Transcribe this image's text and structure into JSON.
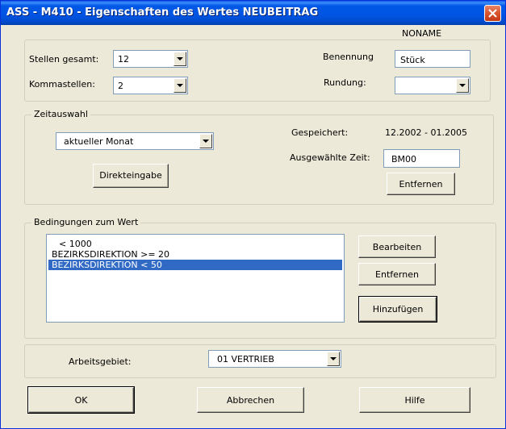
{
  "window": {
    "title": "ASS - M410 - Eigenschaften des Wertes NEUBEITRAG"
  },
  "header": {
    "name_label": "NONAME"
  },
  "format": {
    "stellen_label": "Stellen gesamt:",
    "stellen_value": "12",
    "kommastellen_label": "Kommastellen:",
    "kommastellen_value": "2",
    "benennung_label": "Benennung",
    "benennung_value": "Stück",
    "rundung_label": "Rundung:",
    "rundung_value": ""
  },
  "zeitauswahl": {
    "legend": "Zeitauswahl",
    "period_value": "aktueller Monat",
    "direkteingabe_label": "Direkteingabe",
    "gespeichert_label": "Gespeichert:",
    "gespeichert_value": "12.2002 - 01.2005",
    "ausgewaehlt_label": "Ausgewählte Zeit:",
    "ausgewaehlt_value": "BM00",
    "entfernen_label": "Entfernen"
  },
  "bedingungen": {
    "legend": "Bedingungen zum Wert",
    "items": [
      "< 1000",
      "BEZIRKSDIREKTION >= 20",
      "BEZIRKSDIREKTION < 50"
    ],
    "selected_index": 2,
    "bearbeiten_label": "Bearbeiten",
    "entfernen_label": "Entfernen",
    "hinzufuegen_label": "Hinzufügen"
  },
  "arbeitsgebiet": {
    "label": "Arbeitsgebiet:",
    "value": "01  VERTRIEB"
  },
  "footer": {
    "ok_label": "OK",
    "abbrechen_label": "Abbrechen",
    "hilfe_label": "Hilfe"
  }
}
